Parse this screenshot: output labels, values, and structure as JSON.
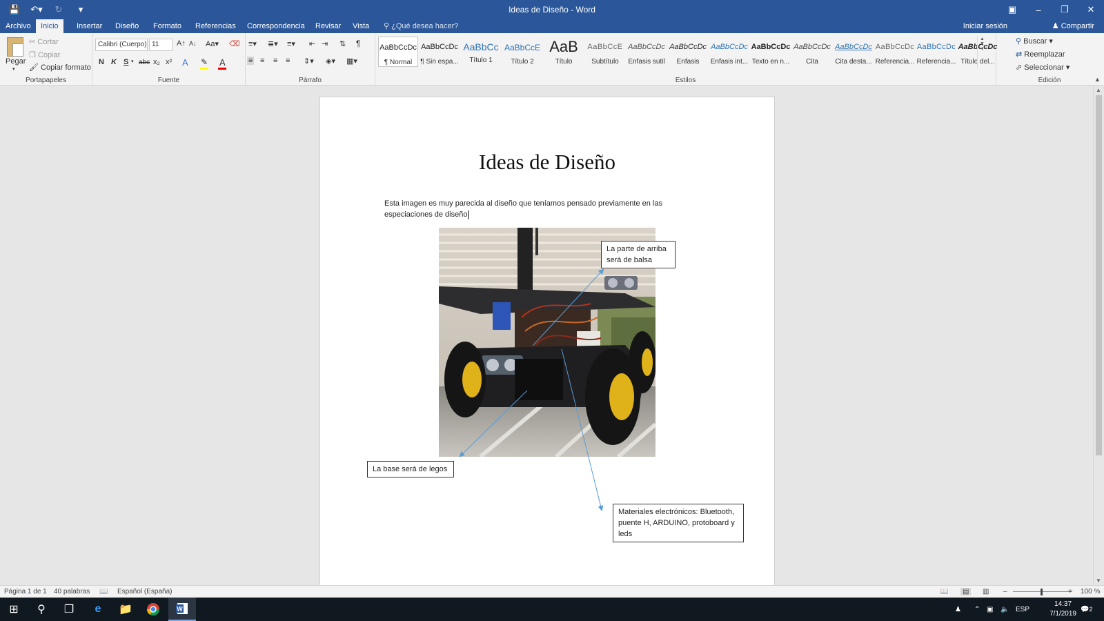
{
  "window": {
    "title": "Ideas de Diseño - Word"
  },
  "tabs": [
    {
      "label": "Archivo"
    },
    {
      "label": "Inicio"
    },
    {
      "label": "Insertar"
    },
    {
      "label": "Diseño"
    },
    {
      "label": "Formato"
    },
    {
      "label": "Referencias"
    },
    {
      "label": "Correspondencia"
    },
    {
      "label": "Revisar"
    },
    {
      "label": "Vista"
    }
  ],
  "tell_me": "¿Qué desea hacer?",
  "account": {
    "signin": "Iniciar sesión",
    "share": "Compartir"
  },
  "ribbon": {
    "clipboard": {
      "paste": "Pegar",
      "cut": "Cortar",
      "copy": "Copiar",
      "format_painter": "Copiar formato",
      "label": "Portapapeles"
    },
    "font": {
      "name": "Calibri (Cuerpo)",
      "size": "11",
      "case_btn": "Aa",
      "bold": "N",
      "italic": "K",
      "underline": "S",
      "strike": "abc",
      "sub": "x₂",
      "sup": "x²",
      "label": "Fuente"
    },
    "paragraph": {
      "label": "Párrafo"
    },
    "styles": {
      "label": "Estilos",
      "items": [
        {
          "sample": "AaBbCcDc",
          "name": "¶ Normal"
        },
        {
          "sample": "AaBbCcDc",
          "name": "¶ Sin espa..."
        },
        {
          "sample": "AaBbCc",
          "name": "Título 1"
        },
        {
          "sample": "AaBbCcE",
          "name": "Título 2"
        },
        {
          "sample": "AaB",
          "name": "Título"
        },
        {
          "sample": "AaBbCcE",
          "name": "Subtítulo"
        },
        {
          "sample": "AaBbCcDc",
          "name": "Énfasis sutil"
        },
        {
          "sample": "AaBbCcDc",
          "name": "Énfasis"
        },
        {
          "sample": "AaBbCcDc",
          "name": "Énfasis int..."
        },
        {
          "sample": "AaBbCcDc",
          "name": "Texto en n..."
        },
        {
          "sample": "AaBbCcDc",
          "name": "Cita"
        },
        {
          "sample": "AaBbCcDc",
          "name": "Cita desta..."
        },
        {
          "sample": "AaBbCcDc",
          "name": "Referencia..."
        },
        {
          "sample": "AaBbCcDc",
          "name": "Referencia..."
        },
        {
          "sample": "AaBbCcDc",
          "name": "Título del..."
        }
      ]
    },
    "editing": {
      "find": "Buscar",
      "replace": "Reemplazar",
      "select": "Seleccionar",
      "label": "Edición"
    }
  },
  "document": {
    "heading": "Ideas de Diseño",
    "paragraph": "Esta imagen es muy parecida al diseño que teníamos pensado previamente en las especiaciones de diseño",
    "callouts": {
      "top": "La parte de arriba será de balsa",
      "left": "La base será de legos",
      "bottom": "Materiales electrónicos: Bluetooth, puente H, ARDUINO, protoboard y leds"
    }
  },
  "status": {
    "page": "Página 1 de 1",
    "words": "40 palabras",
    "language": "Español (España)",
    "zoom": "100 %"
  },
  "taskbar": {
    "lang": "ESP",
    "time": "14:37",
    "date": "7/1/2019",
    "notifications": "2"
  },
  "colors": {
    "word_blue": "#2b579a",
    "ribbon_bg": "#f3f3f3",
    "taskbar_bg": "#101820"
  }
}
